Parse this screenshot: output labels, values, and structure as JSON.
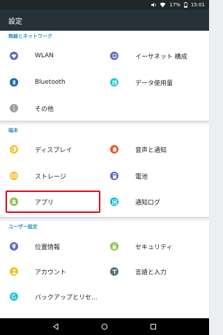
{
  "status_bar": {
    "battery": "17%",
    "time": "15:01"
  },
  "action_bar": {
    "title": "設定"
  },
  "sections": {
    "wireless": {
      "header": "無線とネットワーク",
      "items": [
        "WLAN",
        "イーサネット 構成",
        "Bluetooth",
        "データ使用量",
        "その他"
      ]
    },
    "device": {
      "header": "端末",
      "items": [
        "ディスプレイ",
        "音声と通知",
        "ストレージ",
        "電池",
        "アプリ",
        "通知ログ"
      ]
    },
    "personal": {
      "header": "ユーザー設定",
      "items": [
        "位置情報",
        "セキュリティ",
        "アカウント",
        "言語と入力",
        "バックアップとリセ..."
      ]
    }
  },
  "colors": {
    "section_header": "#2e8fc1",
    "wlan": "#5c6bc0",
    "ethernet": "#5c6bc0",
    "bluetooth": "#1565c0",
    "data_usage": "#26c6da",
    "more": "#9e9e9e",
    "display": "#f5c11a",
    "sound": "#f4511e",
    "storage": "#f5c11a",
    "battery": "#5c6bc0",
    "apps": "#8bc34a",
    "notification_log": "#00bcd4",
    "location": "#5c6bc0",
    "security": "#8bc34a",
    "accounts": "#f5c11a",
    "language": "#546e7a",
    "backup": "#26c6da",
    "highlight_border": "#e50012"
  },
  "icons": {
    "wlan": "wifi-icon",
    "ethernet": "ethernet-icon",
    "bluetooth": "bluetooth-icon",
    "data_usage": "data-usage-icon",
    "more": "more-icon",
    "display": "display-icon",
    "sound": "bell-icon",
    "storage": "storage-icon",
    "battery": "battery-icon",
    "apps": "android-icon",
    "notification_log": "notification-log-icon",
    "location": "location-icon",
    "security": "lock-icon",
    "accounts": "person-icon",
    "language": "language-icon",
    "backup": "backup-icon"
  }
}
